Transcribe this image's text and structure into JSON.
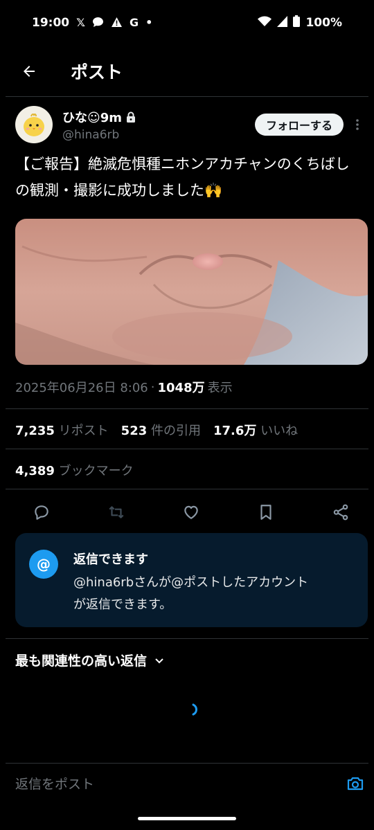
{
  "status_bar": {
    "time": "19:00",
    "left_icons": [
      "x-icon",
      "chat-icon",
      "warning-icon",
      "google-icon",
      "dot-icon"
    ],
    "battery": "100%"
  },
  "header": {
    "title": "ポスト"
  },
  "author": {
    "display_name": "ひな☺9m",
    "handle": "@hina6rb",
    "follow_label": "フォローする"
  },
  "tweet": {
    "text": "【ご報告】絶滅危惧種ニホンアカチャンのくちばしの観測・撮影に成功しました🙌",
    "timestamp": "2025年06月26日 8:06",
    "separator": "·",
    "views_count": "1048万",
    "views_label": "表示"
  },
  "stats": {
    "reposts": {
      "count": "7,235",
      "label": "リポスト"
    },
    "quotes": {
      "count": "523",
      "label": "件の引用"
    },
    "likes": {
      "count": "17.6万",
      "label": "いいね"
    },
    "bookmarks": {
      "count": "4,389",
      "label": "ブックマーク"
    }
  },
  "reply_card": {
    "icon": "@",
    "title": "返信できます",
    "description_line1": "@hina6rbさんが@ポストしたアカウント",
    "description_line2": "が返信できます。"
  },
  "replies": {
    "sort_label": "最も関連性の高い返信"
  },
  "compose": {
    "placeholder": "返信をポスト"
  },
  "colors": {
    "accent": "#1d9bf0",
    "reply_card_bg": "#061b2d",
    "muted": "#71767b"
  }
}
